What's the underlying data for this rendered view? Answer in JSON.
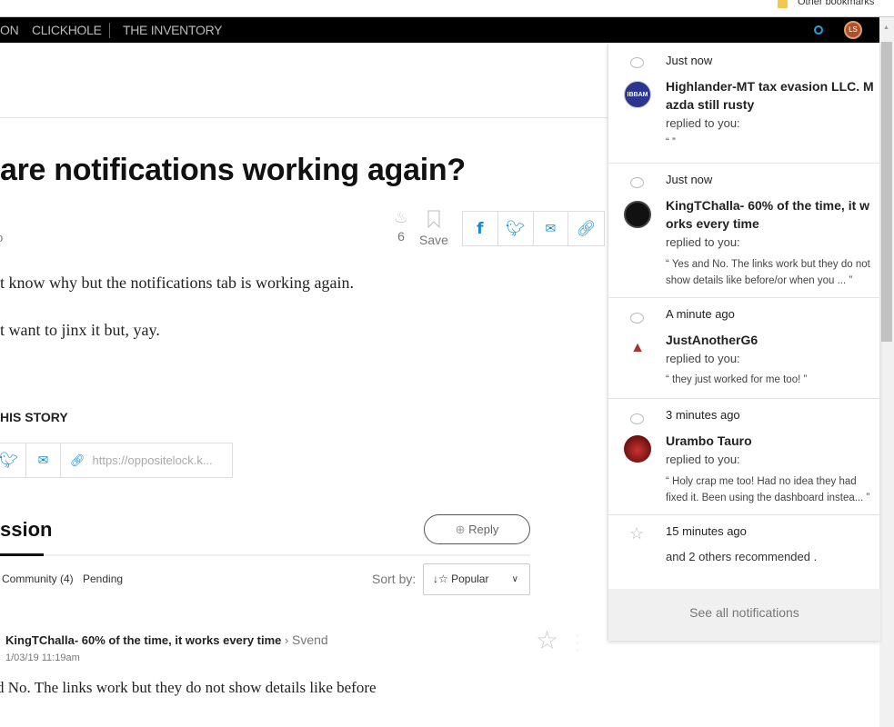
{
  "browser": {
    "bookmarks_label": "Other bookmarks"
  },
  "nav": {
    "items": [
      "ON",
      "CLICKHOLE",
      "THE INVENTORY"
    ],
    "avatar_initials": "LS"
  },
  "article": {
    "title": "are notifications working again?",
    "byline_fragment": "o",
    "reactions_count": "6",
    "save_label": "Save",
    "paragraphs": [
      "t know why but the notifications tab is working again.",
      "t want to jinx it but, yay."
    ],
    "share_heading": "HIS STORY",
    "share_url": "https://oppositelock.k..."
  },
  "discussion": {
    "heading": "ssion",
    "reply_label": "Reply",
    "tabs": [
      "Community (4)",
      "Pending"
    ],
    "sort_label": "Sort by:",
    "sort_value": "Popular",
    "comment": {
      "author": "KingTChalla- 60% of the time, it works every time",
      "reply_to": "Svend",
      "date": "1/03/19 11:19am",
      "text": "d No. The links work but they do not show details like before"
    }
  },
  "notifications": {
    "items": [
      {
        "time": "Just now",
        "name": "Highlander-MT tax evasion LLC. Mazda still rusty",
        "action": "replied to you:",
        "quote": "“ ”",
        "icon": "comment-icon",
        "avatar_text": "IBBAM"
      },
      {
        "time": "Just now",
        "name": "KingTChalla- 60% of the time, it works every time",
        "action": "replied to you:",
        "quote": "“ Yes and No. The links work but they do not show details like before/or when you ... ”",
        "icon": "comment-icon"
      },
      {
        "time": "A minute ago",
        "name": "JustAnotherG6",
        "action": "replied to you:",
        "quote": "“ they just worked for me too!  ”",
        "icon": "comment-icon"
      },
      {
        "time": "3 minutes ago",
        "name": "Urambo Tauro",
        "action": "replied to you:",
        "quote": "“ Holy crap me too! Had no idea they had fixed it. Been using the dashboard instea... ”",
        "icon": "comment-icon"
      },
      {
        "time": "15 minutes ago",
        "text": "and 2 others recommended .",
        "icon": "star-icon"
      }
    ],
    "see_all_label": "See all notifications"
  },
  "colors": {
    "accent": "#1a8bd1",
    "nav_bg": "#000000"
  }
}
